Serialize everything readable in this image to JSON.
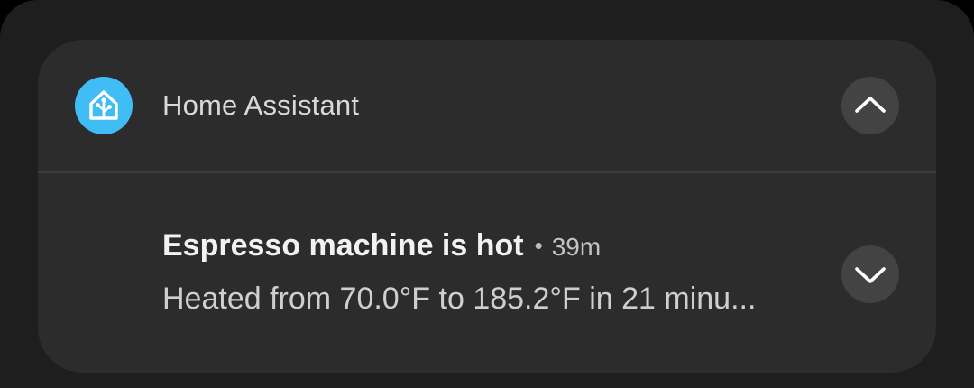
{
  "notification": {
    "app_name": "Home Assistant",
    "app_icon": "home-assistant-icon",
    "title": "Espresso machine is hot",
    "separator": "•",
    "time": "39m",
    "body": "Heated from 70.0°F to 185.2°F in 21 minu...",
    "collapse_icon": "chevron-up-icon",
    "expand_icon": "chevron-down-icon"
  },
  "colors": {
    "app_icon_bg": "#41bdf5",
    "card_bg": "#2c2c2c",
    "button_bg": "#434343",
    "shade_bg": "#1e1e1e"
  }
}
